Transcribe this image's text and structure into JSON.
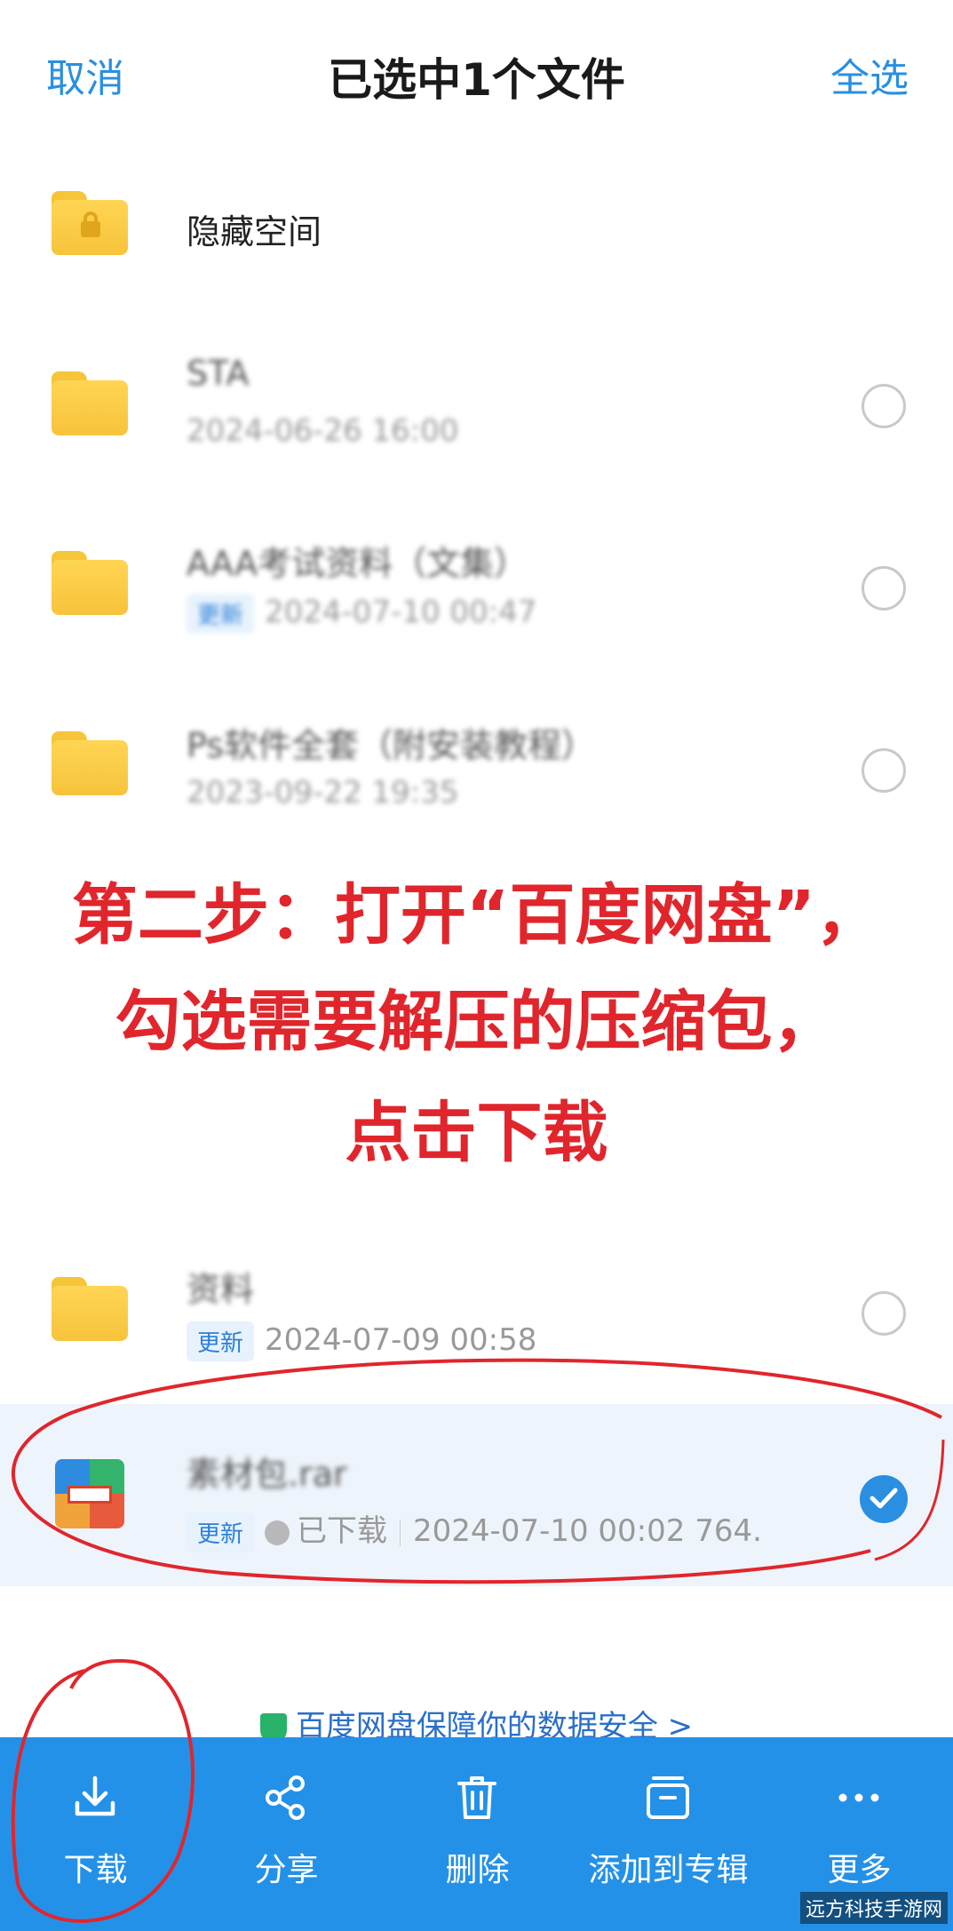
{
  "header": {
    "cancel_label": "取消",
    "title": "已选中1个文件",
    "select_all_label": "全选"
  },
  "rows": [
    {
      "title": "隐藏空间",
      "subtitle": "",
      "badge": ""
    },
    {
      "title": "STA",
      "subtitle": "2024-06-26 16:00",
      "badge": ""
    },
    {
      "title": "AAA考试资料（文集）",
      "subtitle": "2024-07-10 00:47",
      "badge": "更新"
    },
    {
      "title": "Ps软件全套（附安装教程）",
      "subtitle": "2023-09-22 19:35",
      "badge": ""
    },
    {
      "title": "资料",
      "subtitle": "2024-07-09  00:58",
      "badge": "更新"
    },
    {
      "title": "素材包.rar",
      "downloaded": "已下载",
      "subtitle": "2024-07-10  00:02  764.",
      "badge": "更新"
    }
  ],
  "overlay": {
    "line1": "第二步：打开“百度网盘”，",
    "line2": "勾选需要解压的压缩包，",
    "line3": "点击下载"
  },
  "security": {
    "text": "百度网盘保障你的数据安全",
    "arrow": ">"
  },
  "toolbar": {
    "items": [
      {
        "label": "下载",
        "icon": "download-icon"
      },
      {
        "label": "分享",
        "icon": "share-icon"
      },
      {
        "label": "删除",
        "icon": "trash-icon"
      },
      {
        "label": "添加到专辑",
        "icon": "album-icon"
      },
      {
        "label": "更多",
        "icon": "more-icon"
      }
    ]
  },
  "watermark": "远方科技手游网",
  "colors": {
    "accent": "#2a8fe0",
    "toolbar": "#2491e8",
    "annotation": "#e0262c"
  }
}
